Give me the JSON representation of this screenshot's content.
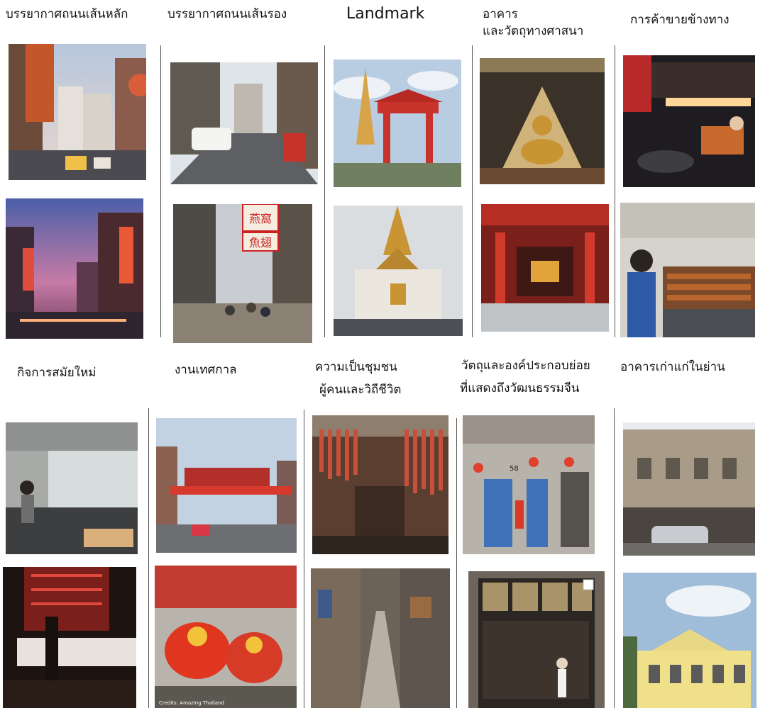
{
  "categories": [
    {
      "id": "main_street",
      "label": "บรรยากาศถนนเส้นหลัก"
    },
    {
      "id": "side_street",
      "label": "บรรยากาศถนนเส้นรอง"
    },
    {
      "id": "landmark",
      "label": "Landmark"
    },
    {
      "id": "religious",
      "label_line1": "อาคาร",
      "label_line2": "และวัตถุทางศาสนา"
    },
    {
      "id": "street_vendors",
      "label": "การค้าขายข้างทาง"
    },
    {
      "id": "modern_business",
      "label": "กิจการสมัยใหม่"
    },
    {
      "id": "festivals",
      "label": "งานเทศกาล"
    },
    {
      "id": "community",
      "label_line1": "ความเป็นชุมชน",
      "label_line2": "ผู้คนและวิถีชีวิต"
    },
    {
      "id": "chinese_culture",
      "label_line1": "วัตถุและองค์ประกอบย่อย",
      "label_line2": "ที่แสดงถึงวัฒนธรรมจีน"
    },
    {
      "id": "old_buildings",
      "label": "อาคารเก่าแก่ในย่าน"
    }
  ],
  "photo_credit": "Credits: Amazing Thailand",
  "sign_text": {
    "bird_nest": "燕窩",
    "shark_fin": "魚翅",
    "shop_number": "58"
  }
}
